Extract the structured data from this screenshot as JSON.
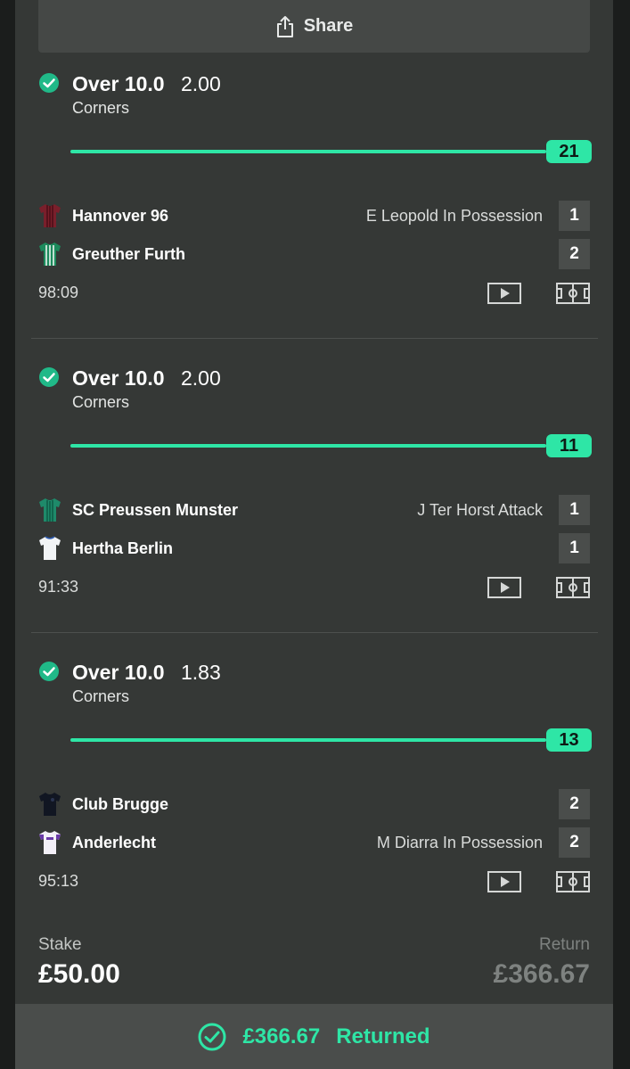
{
  "share": {
    "label": "Share",
    "icon": "share-icon"
  },
  "accent_color": "#2ee6a6",
  "selections": [
    {
      "selection": "Over 10.0",
      "odds": "2.00",
      "market": "Corners",
      "count": "21",
      "teams": [
        {
          "name": "Hannover 96",
          "status": "E Leopold In Possession",
          "score": "1",
          "kit_colors": [
            "#7a1f2b",
            "#4a0f18"
          ]
        },
        {
          "name": "Greuther Furth",
          "status": "",
          "score": "2",
          "kit_colors": [
            "#1c8a5c",
            "#e8f3ee"
          ]
        }
      ],
      "clock": "98:09"
    },
    {
      "selection": "Over 10.0",
      "odds": "2.00",
      "market": "Corners",
      "count": "11",
      "teams": [
        {
          "name": "SC Preussen Munster",
          "status": "J Ter Horst Attack",
          "score": "1",
          "kit_colors": [
            "#1e8a6a",
            "#0f5a44"
          ]
        },
        {
          "name": "Hertha Berlin",
          "status": "",
          "score": "1",
          "kit_colors": [
            "#f2f4f6",
            "#2d5ab0"
          ]
        }
      ],
      "clock": "91:33"
    },
    {
      "selection": "Over 10.0",
      "odds": "1.83",
      "market": "Corners",
      "count": "13",
      "teams": [
        {
          "name": "Club Brugge",
          "status": "",
          "score": "2",
          "kit_colors": [
            "#111622",
            "#2a3450"
          ]
        },
        {
          "name": "Anderlecht",
          "status": "M Diarra In Possession",
          "score": "2",
          "kit_colors": [
            "#f3f0f8",
            "#6a3aa8"
          ]
        }
      ],
      "clock": "95:13"
    }
  ],
  "stake": {
    "label": "Stake",
    "value": "£50.00"
  },
  "return": {
    "label": "Return",
    "value": "£366.67"
  },
  "result": {
    "amount": "£366.67",
    "label": "Returned",
    "icon": "check-circle-icon"
  }
}
